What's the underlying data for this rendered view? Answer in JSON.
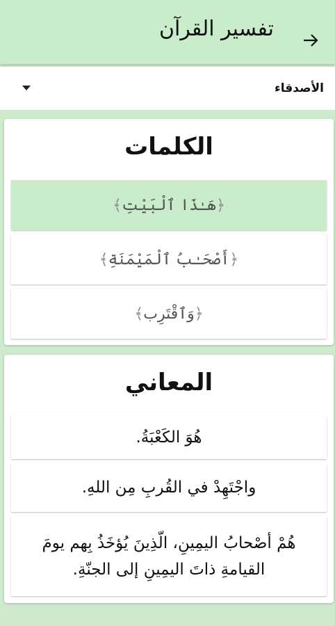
{
  "header": {
    "title": "تفسير القرآن",
    "back_icon": "arrow-right-icon"
  },
  "filter": {
    "selected": "الأصدقاء",
    "caret_icon": "caret-down-icon"
  },
  "words_card": {
    "title": "الكلمات",
    "items": [
      {
        "text": "هَـٰذَا ٱلْبَيْتِ",
        "selected": true
      },
      {
        "text": "أَصْحَـٰبُ ٱلْمَيْمَنَةِ",
        "selected": false
      },
      {
        "text": "وَٱقْتَرِب",
        "selected": false
      }
    ],
    "open_bracket": "﴿",
    "close_bracket": "﴾"
  },
  "meanings_card": {
    "title": "المعاني",
    "items": [
      "هُوَ الكَعْبَةُ.",
      "واجْتَهِدْ في القُربِ مِن اللهِ.",
      "هُمْ أصْحابُ اليمِينِ، الّذِينَ يُؤخَذُ بِهم يومَ القيامةِ ذاتَ اليمِينِ إلى الجنّةِ."
    ]
  },
  "colors": {
    "accent": "#c9eccb",
    "background": "#cfeacd",
    "card": "#ffffff"
  }
}
